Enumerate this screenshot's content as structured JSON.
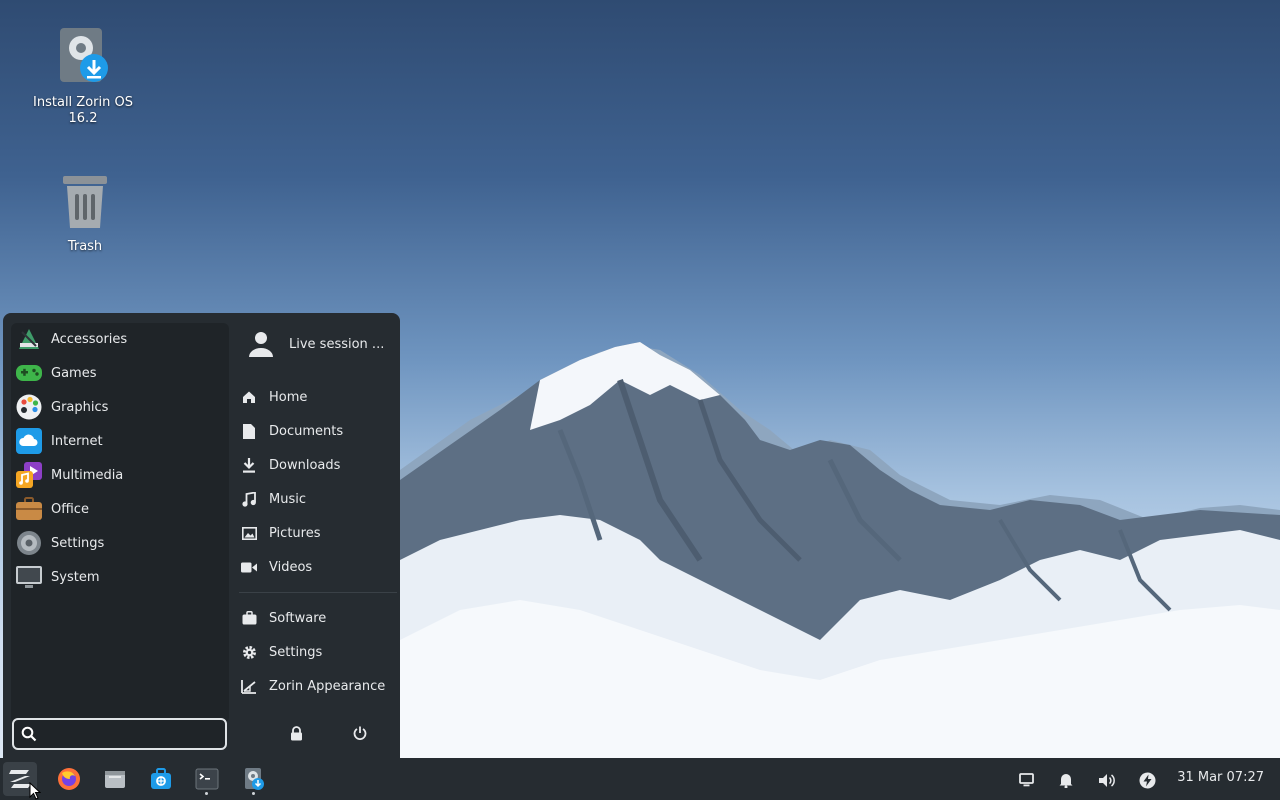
{
  "desktop": {
    "installer": {
      "label": "Install Zorin OS 16.2"
    },
    "trash": {
      "label": "Trash"
    }
  },
  "menu": {
    "categories": [
      {
        "label": "Accessories",
        "icon": "accessories-icon"
      },
      {
        "label": "Games",
        "icon": "gamepad-icon"
      },
      {
        "label": "Graphics",
        "icon": "palette-icon"
      },
      {
        "label": "Internet",
        "icon": "cloud-icon"
      },
      {
        "label": "Multimedia",
        "icon": "multimedia-icon"
      },
      {
        "label": "Office",
        "icon": "briefcase-icon"
      },
      {
        "label": "Settings",
        "icon": "gear-icon"
      },
      {
        "label": "System",
        "icon": "monitor-icon"
      }
    ],
    "user": {
      "label": "Live session ..."
    },
    "places": [
      {
        "label": "Home",
        "icon": "home-icon"
      },
      {
        "label": "Documents",
        "icon": "document-icon"
      },
      {
        "label": "Downloads",
        "icon": "download-icon"
      },
      {
        "label": "Music",
        "icon": "music-icon"
      },
      {
        "label": "Pictures",
        "icon": "picture-icon"
      },
      {
        "label": "Videos",
        "icon": "video-icon"
      }
    ],
    "system_links": [
      {
        "label": "Software",
        "icon": "software-store-icon"
      },
      {
        "label": "Settings",
        "icon": "gear-icon"
      },
      {
        "label": "Zorin Appearance",
        "icon": "appearance-icon"
      }
    ],
    "search": {
      "value": "",
      "placeholder": ""
    }
  },
  "taskbar": {
    "clock": "31 Mar 07:27"
  },
  "colors": {
    "panel": "#262c31",
    "category_pane": "#1f2428",
    "accent_blue": "#1e9be8"
  }
}
